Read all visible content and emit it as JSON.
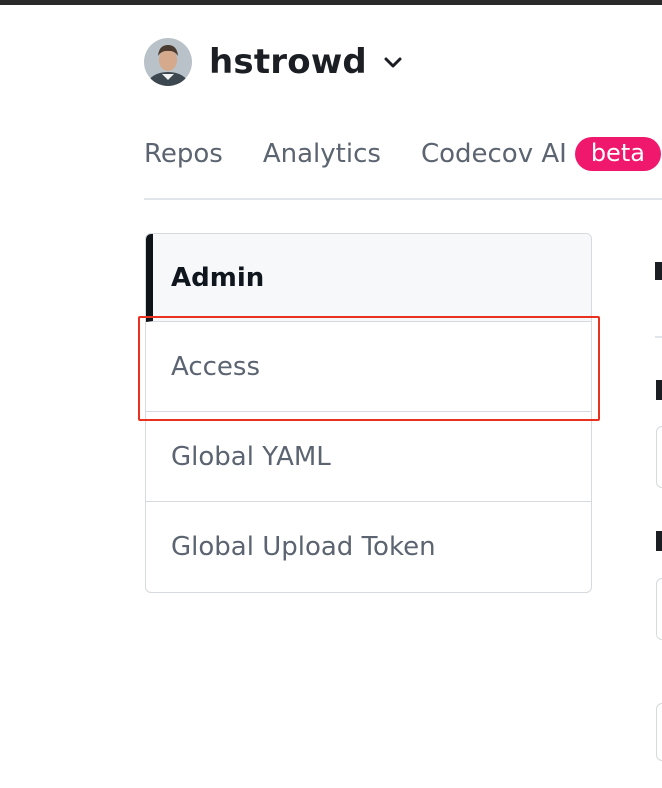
{
  "org": {
    "name": "hstrowd",
    "avatar_icon": "user-avatar"
  },
  "tabs": [
    {
      "label": "Repos"
    },
    {
      "label": "Analytics"
    },
    {
      "label": "Codecov AI",
      "badge": "beta"
    }
  ],
  "admin_menu": {
    "title": "Admin",
    "items": [
      {
        "label": "Access",
        "highlighted": true
      },
      {
        "label": "Global YAML"
      },
      {
        "label": "Global Upload Token"
      }
    ]
  },
  "colors": {
    "badge": "#f0186d",
    "highlight": "#e8321f",
    "text_muted": "#5b6470",
    "text_dark": "#10161d"
  }
}
